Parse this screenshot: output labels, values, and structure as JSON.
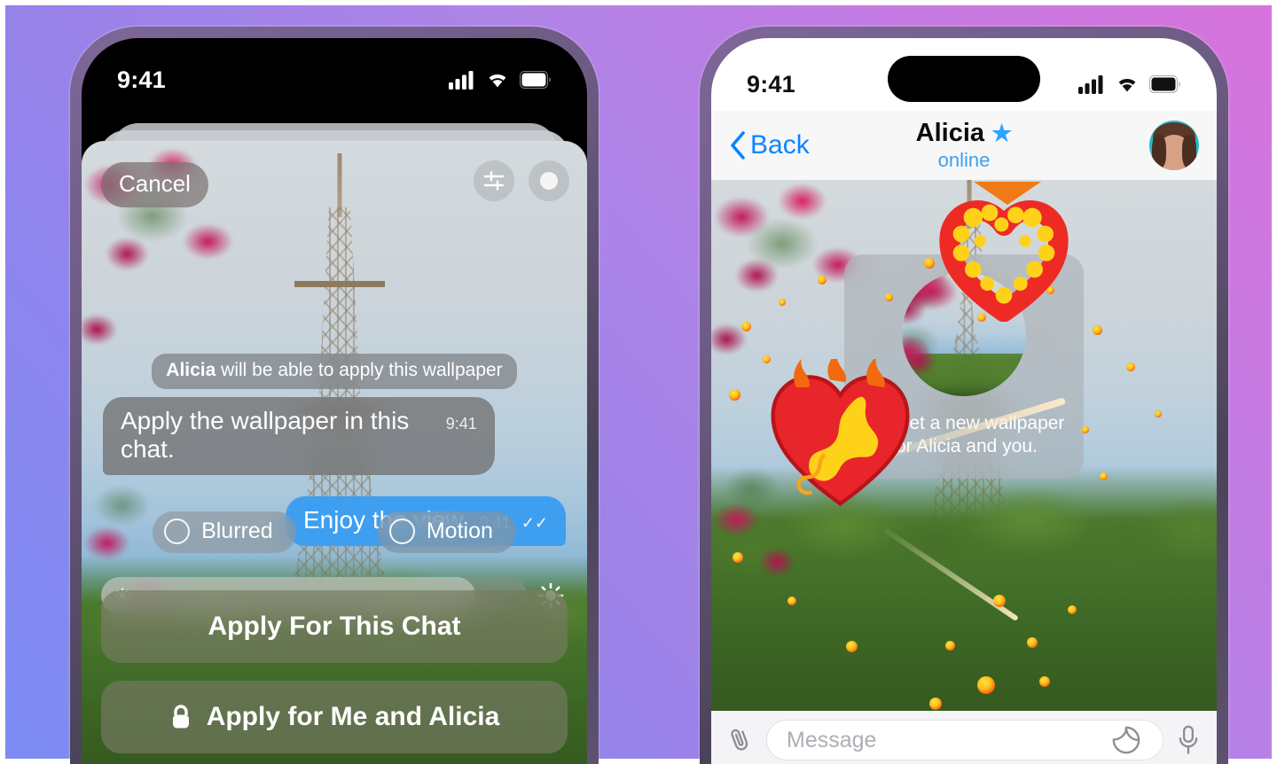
{
  "background": {
    "gradient_from": "#7C8CF2",
    "gradient_mid": "#AE84E8",
    "gradient_to": "#D873DC"
  },
  "left_phone": {
    "status_bar": {
      "time": "9:41",
      "icons": [
        "cellular-signal-icon",
        "wifi-icon",
        "battery-icon"
      ]
    },
    "sheet": {
      "cancel_label": "Cancel",
      "tools": [
        {
          "name": "adjustments-icon"
        },
        {
          "name": "color-dot-icon"
        }
      ],
      "service_message_prefix": "Alicia",
      "service_message_rest": " will be able to apply this wallpaper",
      "messages": [
        {
          "direction": "incoming",
          "text": "Apply the wallpaper in this chat.",
          "time": "9:41",
          "ticks": ""
        },
        {
          "direction": "outgoing",
          "text": "Enjoy the view.",
          "time": "9:41",
          "ticks": "✓✓"
        }
      ],
      "chips": [
        {
          "label": "Blurred",
          "selected": false
        },
        {
          "label": "Motion",
          "selected": false
        }
      ],
      "brightness_slider": {
        "value_percent": 88,
        "left_icon": "sun-dim-icon",
        "right_icon": "sun-bright-icon"
      },
      "primary_button": "Apply For This Chat",
      "secondary_button": "Apply for Me and Alicia",
      "secondary_button_icon": "lock-icon"
    }
  },
  "right_phone": {
    "status_bar": {
      "time": "9:41",
      "icons": [
        "cellular-signal-icon",
        "wifi-icon",
        "battery-icon"
      ]
    },
    "nav_bar": {
      "back_label": "Back",
      "title": "Alicia",
      "title_badge": "★",
      "subtitle": "online",
      "avatar_alt": "alicia-avatar"
    },
    "wallpaper_card": {
      "text": "You set a new wallpaper for Alicia and you."
    },
    "stickers": [
      {
        "name": "burning-heart-sticker"
      },
      {
        "name": "fire-ring-heart-sticker"
      },
      {
        "name": "orange-arrow-sticker"
      }
    ],
    "input_bar": {
      "attach_icon": "paperclip-icon",
      "placeholder": "Message",
      "sticker_icon": "sticker-icon",
      "mic_icon": "microphone-icon"
    }
  }
}
